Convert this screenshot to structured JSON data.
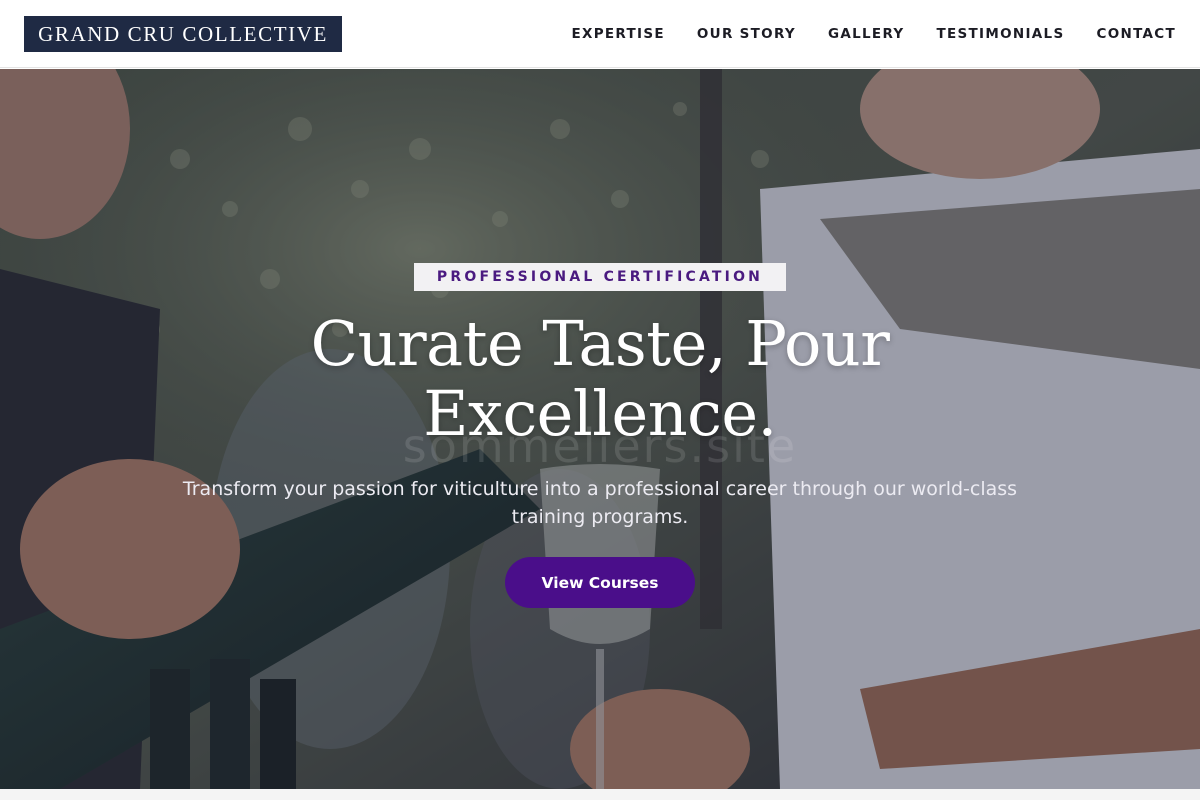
{
  "header": {
    "logo_text": "GRAND CRU COLLECTIVE",
    "nav_items": [
      "EXPERTISE",
      "OUR STORY",
      "GALLERY",
      "TESTIMONIALS",
      "CONTACT"
    ]
  },
  "hero": {
    "badge": "PROFESSIONAL CERTIFICATION",
    "title": "Curate Taste, Pour Excellence.",
    "subtitle": "Transform your passion for viticulture into a professional career through our world-class training programs.",
    "cta_label": "View Courses",
    "watermark": "sommeliers.site"
  },
  "colors": {
    "logo_background": "#1f2a44",
    "accent_purple": "#4a0e8a",
    "badge_text": "#4a1a80",
    "overlay": "#1c1e38"
  }
}
